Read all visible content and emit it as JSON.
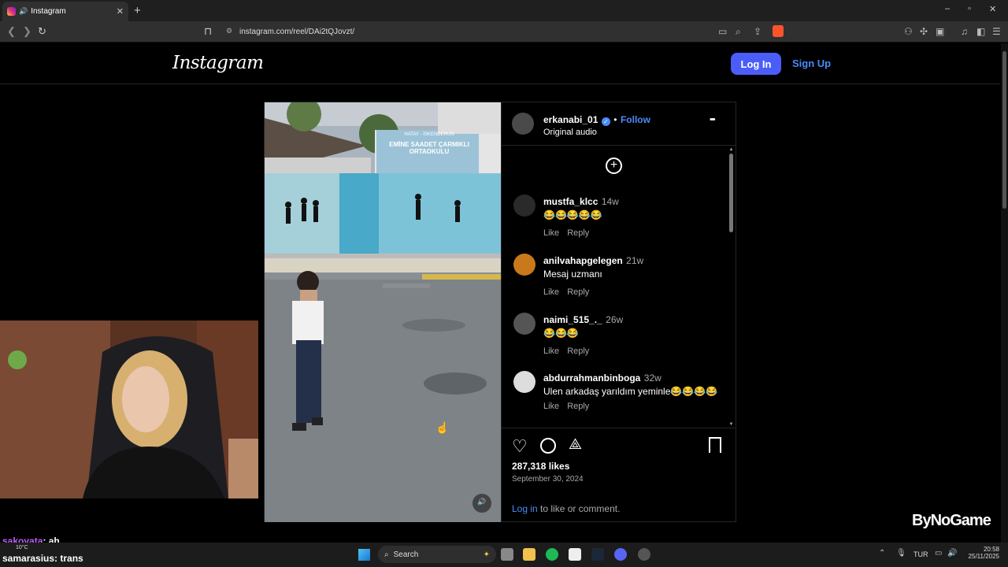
{
  "browser": {
    "tab_title": "Instagram",
    "new_tab": "+",
    "url": "instagram.com/reel/DAi2tQJovzt/",
    "window_controls": [
      "–",
      "▫",
      "✕"
    ]
  },
  "instagram": {
    "logo": "Instagram",
    "login_label": "Log In",
    "signup_label": "Sign Up"
  },
  "post": {
    "author": "erkanabi_01",
    "follow_label": "Follow",
    "audio": "Original audio",
    "more_label": "•••",
    "likes": "287,318 likes",
    "date": "September 30, 2024",
    "login_prompt_link": "Log in",
    "login_prompt_rest": " to like or comment.",
    "comments": [
      {
        "user": "mustfa_klcc",
        "time": "14w",
        "text": "😂😂😂😂😂",
        "like": "Like",
        "reply": "Reply"
      },
      {
        "user": "anilvahapgelegen",
        "time": "21w",
        "text": "Mesaj uzmanı",
        "like": "Like",
        "reply": "Reply"
      },
      {
        "user": "naimi_515_._",
        "time": "26w",
        "text": "😂😂😂",
        "like": "Like",
        "reply": "Reply"
      },
      {
        "user": "abdurrahmanbinboga",
        "time": "32w",
        "text": "Ulen arkadaş yarıldım yeminle😂😂😂😂",
        "like": "Like",
        "reply": "Reply"
      }
    ]
  },
  "video_scene": {
    "sign_line1": "HATAY - İSKENDERUN",
    "sign_line2": "EMİNE SAADET ÇARMIKLI",
    "sign_line3": "ORTAOKULU"
  },
  "chat": [
    {
      "user": "sakovata",
      "msg": ": ah"
    },
    {
      "user": "samarasius",
      "msg": ": trans"
    }
  ],
  "taskbar": {
    "search_label": "Search",
    "weather": "10°C",
    "lang": "TUR",
    "time": "20:58",
    "date": "25/11/2025"
  },
  "watermark": "ByNoGame",
  "colors": {
    "accent": "#4a5df9",
    "link": "#4a8bfa",
    "follow": "#4a8bfa"
  }
}
